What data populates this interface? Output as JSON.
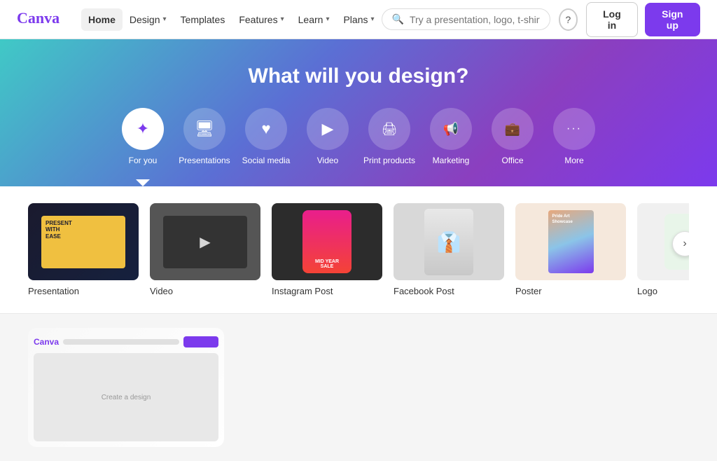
{
  "nav": {
    "logo_text": "Canva",
    "home_label": "Home",
    "design_label": "Design",
    "templates_label": "Templates",
    "features_label": "Features",
    "learn_label": "Learn",
    "plans_label": "Plans",
    "search_placeholder": "Try a presentation, logo, t-shirt, an...",
    "help_icon": "?",
    "login_label": "Log in",
    "signup_label": "Sign up"
  },
  "hero": {
    "title": "What will you design?"
  },
  "categories": [
    {
      "id": "for-you",
      "label": "For you",
      "icon": "✦",
      "selected": true
    },
    {
      "id": "presentations",
      "label": "Presentations",
      "icon": "🖥",
      "selected": false
    },
    {
      "id": "social-media",
      "label": "Social media",
      "icon": "♥",
      "selected": false
    },
    {
      "id": "video",
      "label": "Video",
      "icon": "▶",
      "selected": false
    },
    {
      "id": "print-products",
      "label": "Print products",
      "icon": "🖨",
      "selected": false
    },
    {
      "id": "marketing",
      "label": "Marketing",
      "icon": "📢",
      "selected": false
    },
    {
      "id": "office",
      "label": "Office",
      "icon": "💼",
      "selected": false
    },
    {
      "id": "more",
      "label": "More",
      "icon": "···",
      "selected": false
    }
  ],
  "design_cards": [
    {
      "id": "presentation",
      "label": "Presentation",
      "thumb_type": "presentation"
    },
    {
      "id": "video",
      "label": "Video",
      "thumb_type": "video"
    },
    {
      "id": "instagram-post",
      "label": "Instagram Post",
      "thumb_type": "instagram"
    },
    {
      "id": "facebook-post",
      "label": "Facebook Post",
      "thumb_type": "facebook"
    },
    {
      "id": "poster",
      "label": "Poster",
      "thumb_type": "poster"
    },
    {
      "id": "logo",
      "label": "Logo",
      "thumb_type": "logo"
    }
  ],
  "next_btn_label": "›",
  "accent_color": "#7c3aed"
}
